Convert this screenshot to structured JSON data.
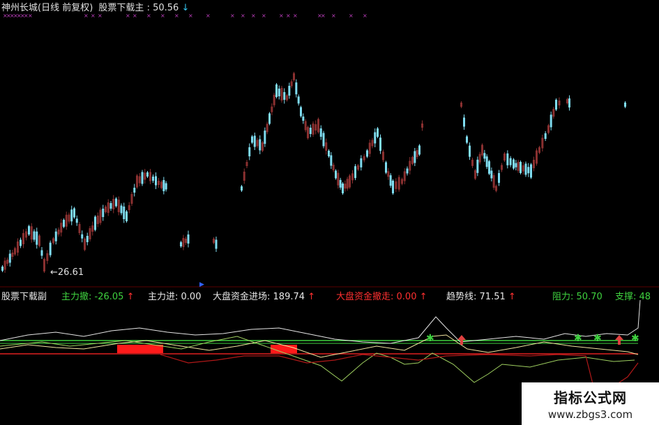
{
  "header": {
    "title": "神州长城(日线 前复权)",
    "indicator_label": "股票下载主",
    "indicator_value": "50.56",
    "arrow": "↓"
  },
  "main_chart": {
    "low_label": "26.61"
  },
  "sub_indicator": {
    "name": "股票下载副",
    "items": [
      {
        "label": "主力撤:",
        "value": "-26.05",
        "arrow": "↑",
        "color": "#3fd23f"
      },
      {
        "label": "主力进:",
        "value": "0.00",
        "arrow": "",
        "color": "#e8e8e8"
      },
      {
        "label": "大盘资金进场:",
        "value": "189.74",
        "arrow": "↑",
        "color": "#e8e8e8"
      },
      {
        "label": "大盘资金撤走:",
        "value": "0.00",
        "arrow": "↑",
        "color": "#ff3030"
      },
      {
        "label": "趋势线:",
        "value": "71.51",
        "arrow": "↑",
        "color": "#e8e8e8"
      }
    ],
    "resistance_label": "阻力:",
    "resistance_value": "50.70",
    "support_label": "支撑:",
    "support_value": "48"
  },
  "watermark": {
    "line1": "指标公式网",
    "line2": "www.zbgs3.com"
  },
  "colors": {
    "up": "#8a3030",
    "down": "#7fdcf0",
    "green_line": "#3fd23f",
    "red_line": "#e02020",
    "white_line": "#e6e6e6",
    "cream_line": "#f3e6a0",
    "marker_green": "#3fd23f",
    "marker_red": "#e04040"
  }
}
